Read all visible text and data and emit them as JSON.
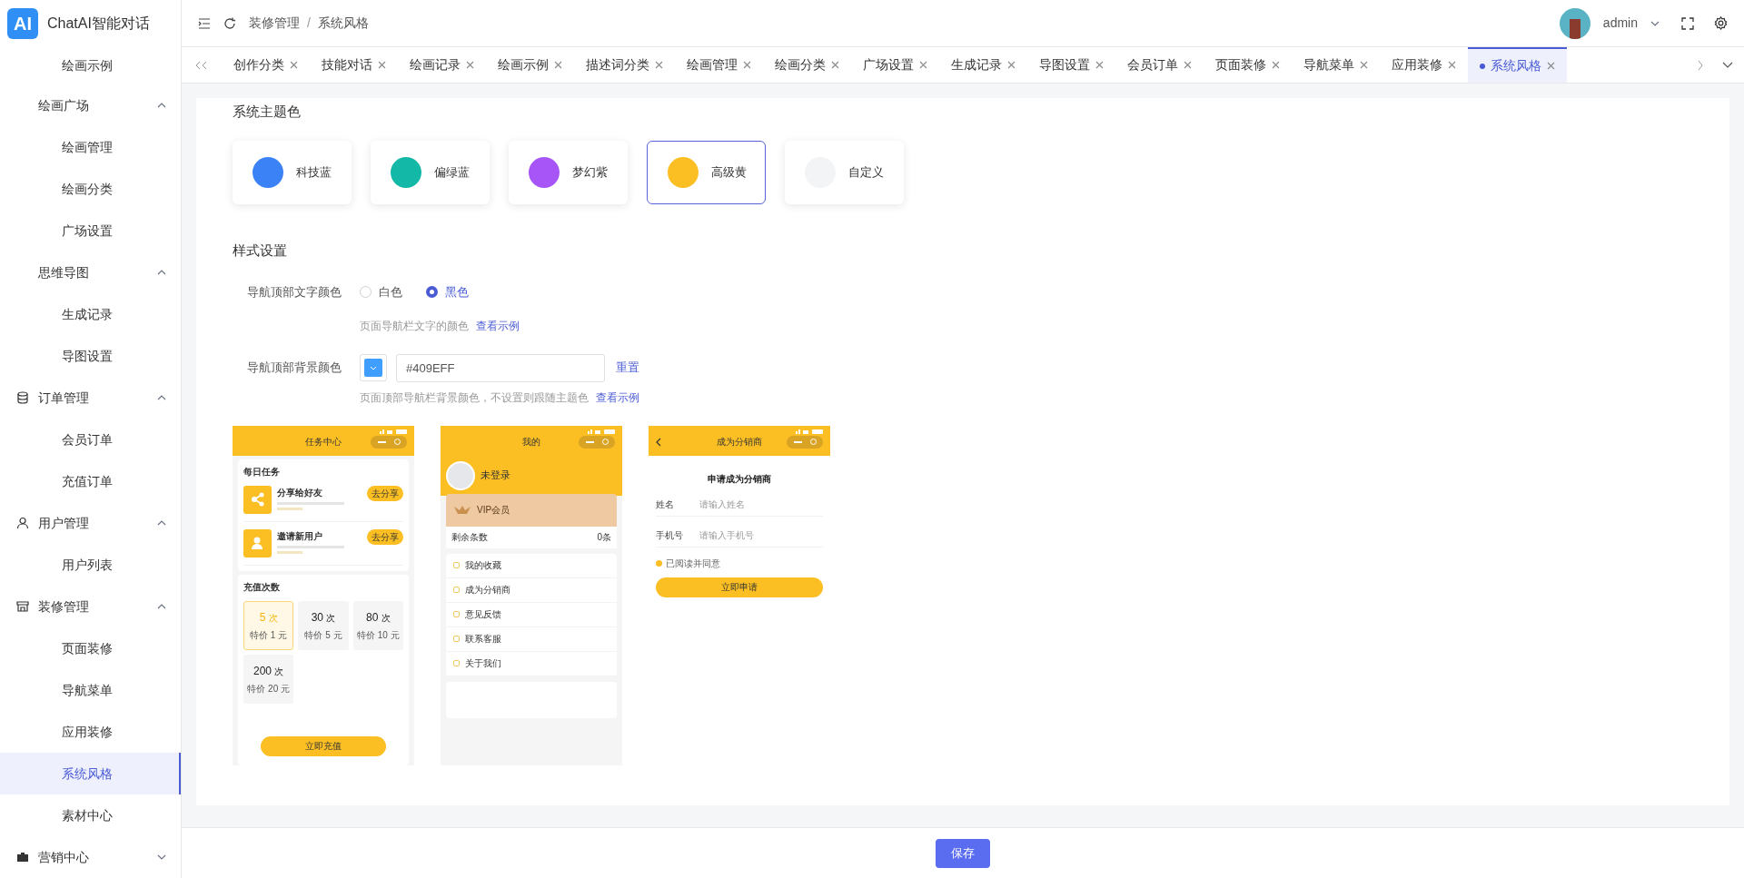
{
  "brand": {
    "mark": "AI",
    "name": "ChatAI智能对话"
  },
  "breadcrumb": [
    "装修管理",
    "系统风格"
  ],
  "breadcrumb_separator": "/",
  "user": {
    "name": "admin"
  },
  "tabs": [
    {
      "label": "创作分类",
      "selected": false
    },
    {
      "label": "技能对话",
      "selected": false
    },
    {
      "label": "绘画记录",
      "selected": false
    },
    {
      "label": "绘画示例",
      "selected": false
    },
    {
      "label": "描述词分类",
      "selected": false
    },
    {
      "label": "绘画管理",
      "selected": false
    },
    {
      "label": "绘画分类",
      "selected": false
    },
    {
      "label": "广场设置",
      "selected": false
    },
    {
      "label": "生成记录",
      "selected": false
    },
    {
      "label": "导图设置",
      "selected": false
    },
    {
      "label": "会员订单",
      "selected": false
    },
    {
      "label": "页面装修",
      "selected": false
    },
    {
      "label": "导航菜单",
      "selected": false
    },
    {
      "label": "应用装修",
      "selected": false
    },
    {
      "label": "系统风格",
      "selected": true
    }
  ],
  "sidebar": {
    "items": [
      {
        "kind": "link",
        "label": "绘画示例",
        "selected": false
      },
      {
        "kind": "group",
        "label": "绘画广场",
        "expanded": true,
        "children": [
          {
            "label": "绘画管理",
            "selected": false
          },
          {
            "label": "绘画分类",
            "selected": false
          },
          {
            "label": "广场设置",
            "selected": false
          }
        ]
      },
      {
        "kind": "group",
        "label": "思维导图",
        "expanded": true,
        "children": [
          {
            "label": "生成记录",
            "selected": false
          },
          {
            "label": "导图设置",
            "selected": false
          }
        ]
      },
      {
        "kind": "section",
        "label": "订单管理",
        "expanded": true,
        "children": [
          {
            "label": "会员订单",
            "selected": false
          },
          {
            "label": "充值订单",
            "selected": false
          }
        ]
      },
      {
        "kind": "section",
        "label": "用户管理",
        "expanded": true,
        "children": [
          {
            "label": "用户列表",
            "selected": false
          }
        ]
      },
      {
        "kind": "section",
        "label": "装修管理",
        "expanded": true,
        "children": [
          {
            "label": "页面装修",
            "selected": false
          },
          {
            "label": "导航菜单",
            "selected": false
          },
          {
            "label": "应用装修",
            "selected": false
          },
          {
            "label": "系统风格",
            "selected": true
          },
          {
            "label": "素材中心",
            "selected": false
          }
        ]
      },
      {
        "kind": "section",
        "label": "营销中心",
        "expanded": false
      }
    ]
  },
  "theme": {
    "title": "系统主题色",
    "options": [
      {
        "label": "科技蓝",
        "color": "#3b82f6",
        "selected": false
      },
      {
        "label": "偏绿蓝",
        "color": "#14b8a6",
        "selected": false
      },
      {
        "label": "梦幻紫",
        "color": "#a855f7",
        "selected": false
      },
      {
        "label": "高级黄",
        "color": "#fbbf24",
        "selected": true
      },
      {
        "label": "自定义",
        "color": "#f3f4f6",
        "selected": false
      }
    ]
  },
  "style": {
    "title": "样式设置",
    "text_color": {
      "label": "导航顶部文字颜色",
      "options": [
        {
          "label": "白色",
          "selected": false
        },
        {
          "label": "黑色",
          "selected": true
        }
      ],
      "hint": "页面导航栏文字的颜色",
      "link": "查看示例"
    },
    "bg_color": {
      "label": "导航顶部背景颜色",
      "color": "#409eff",
      "value": "#409EFF",
      "reset": "重置",
      "hint": "页面顶部导航栏背景颜色，不设置则跟随主题色",
      "link": "查看示例"
    }
  },
  "previews": [
    {
      "kind": "tasks",
      "title": "任务中心",
      "section_title": "每日任务",
      "tasks": [
        {
          "title": "分享给好友",
          "button": "去分享"
        },
        {
          "title": "邀请新用户",
          "button": "去分享"
        }
      ],
      "recharge_title": "充值次数",
      "packages": [
        {
          "count": "5",
          "unit": "次",
          "price": "特价 1 元",
          "selected": true
        },
        {
          "count": "30",
          "unit": "次",
          "price": "特价 5 元",
          "selected": false
        },
        {
          "count": "80",
          "unit": "次",
          "price": "特价 10 元",
          "selected": false
        },
        {
          "count": "200",
          "unit": "次",
          "price": "特价 20 元",
          "selected": false
        }
      ],
      "button": "立即充值"
    },
    {
      "kind": "profile",
      "title": "我的",
      "user": "未登录",
      "vip": "VIP会员",
      "balance_label": "剩余条数",
      "balance": "0条",
      "menu": [
        "我的收藏",
        "成为分销商",
        "意见反馈",
        "联系客服",
        "关于我们"
      ]
    },
    {
      "kind": "form",
      "title": "成为分销商",
      "heading": "申请成为分销商",
      "fields": [
        {
          "label": "姓名",
          "placeholder": "请输入姓名"
        },
        {
          "label": "手机号",
          "placeholder": "请输入手机号"
        }
      ],
      "agree": "已阅读并同意",
      "checked": true,
      "button": "立即申请"
    }
  ],
  "save": "保存"
}
